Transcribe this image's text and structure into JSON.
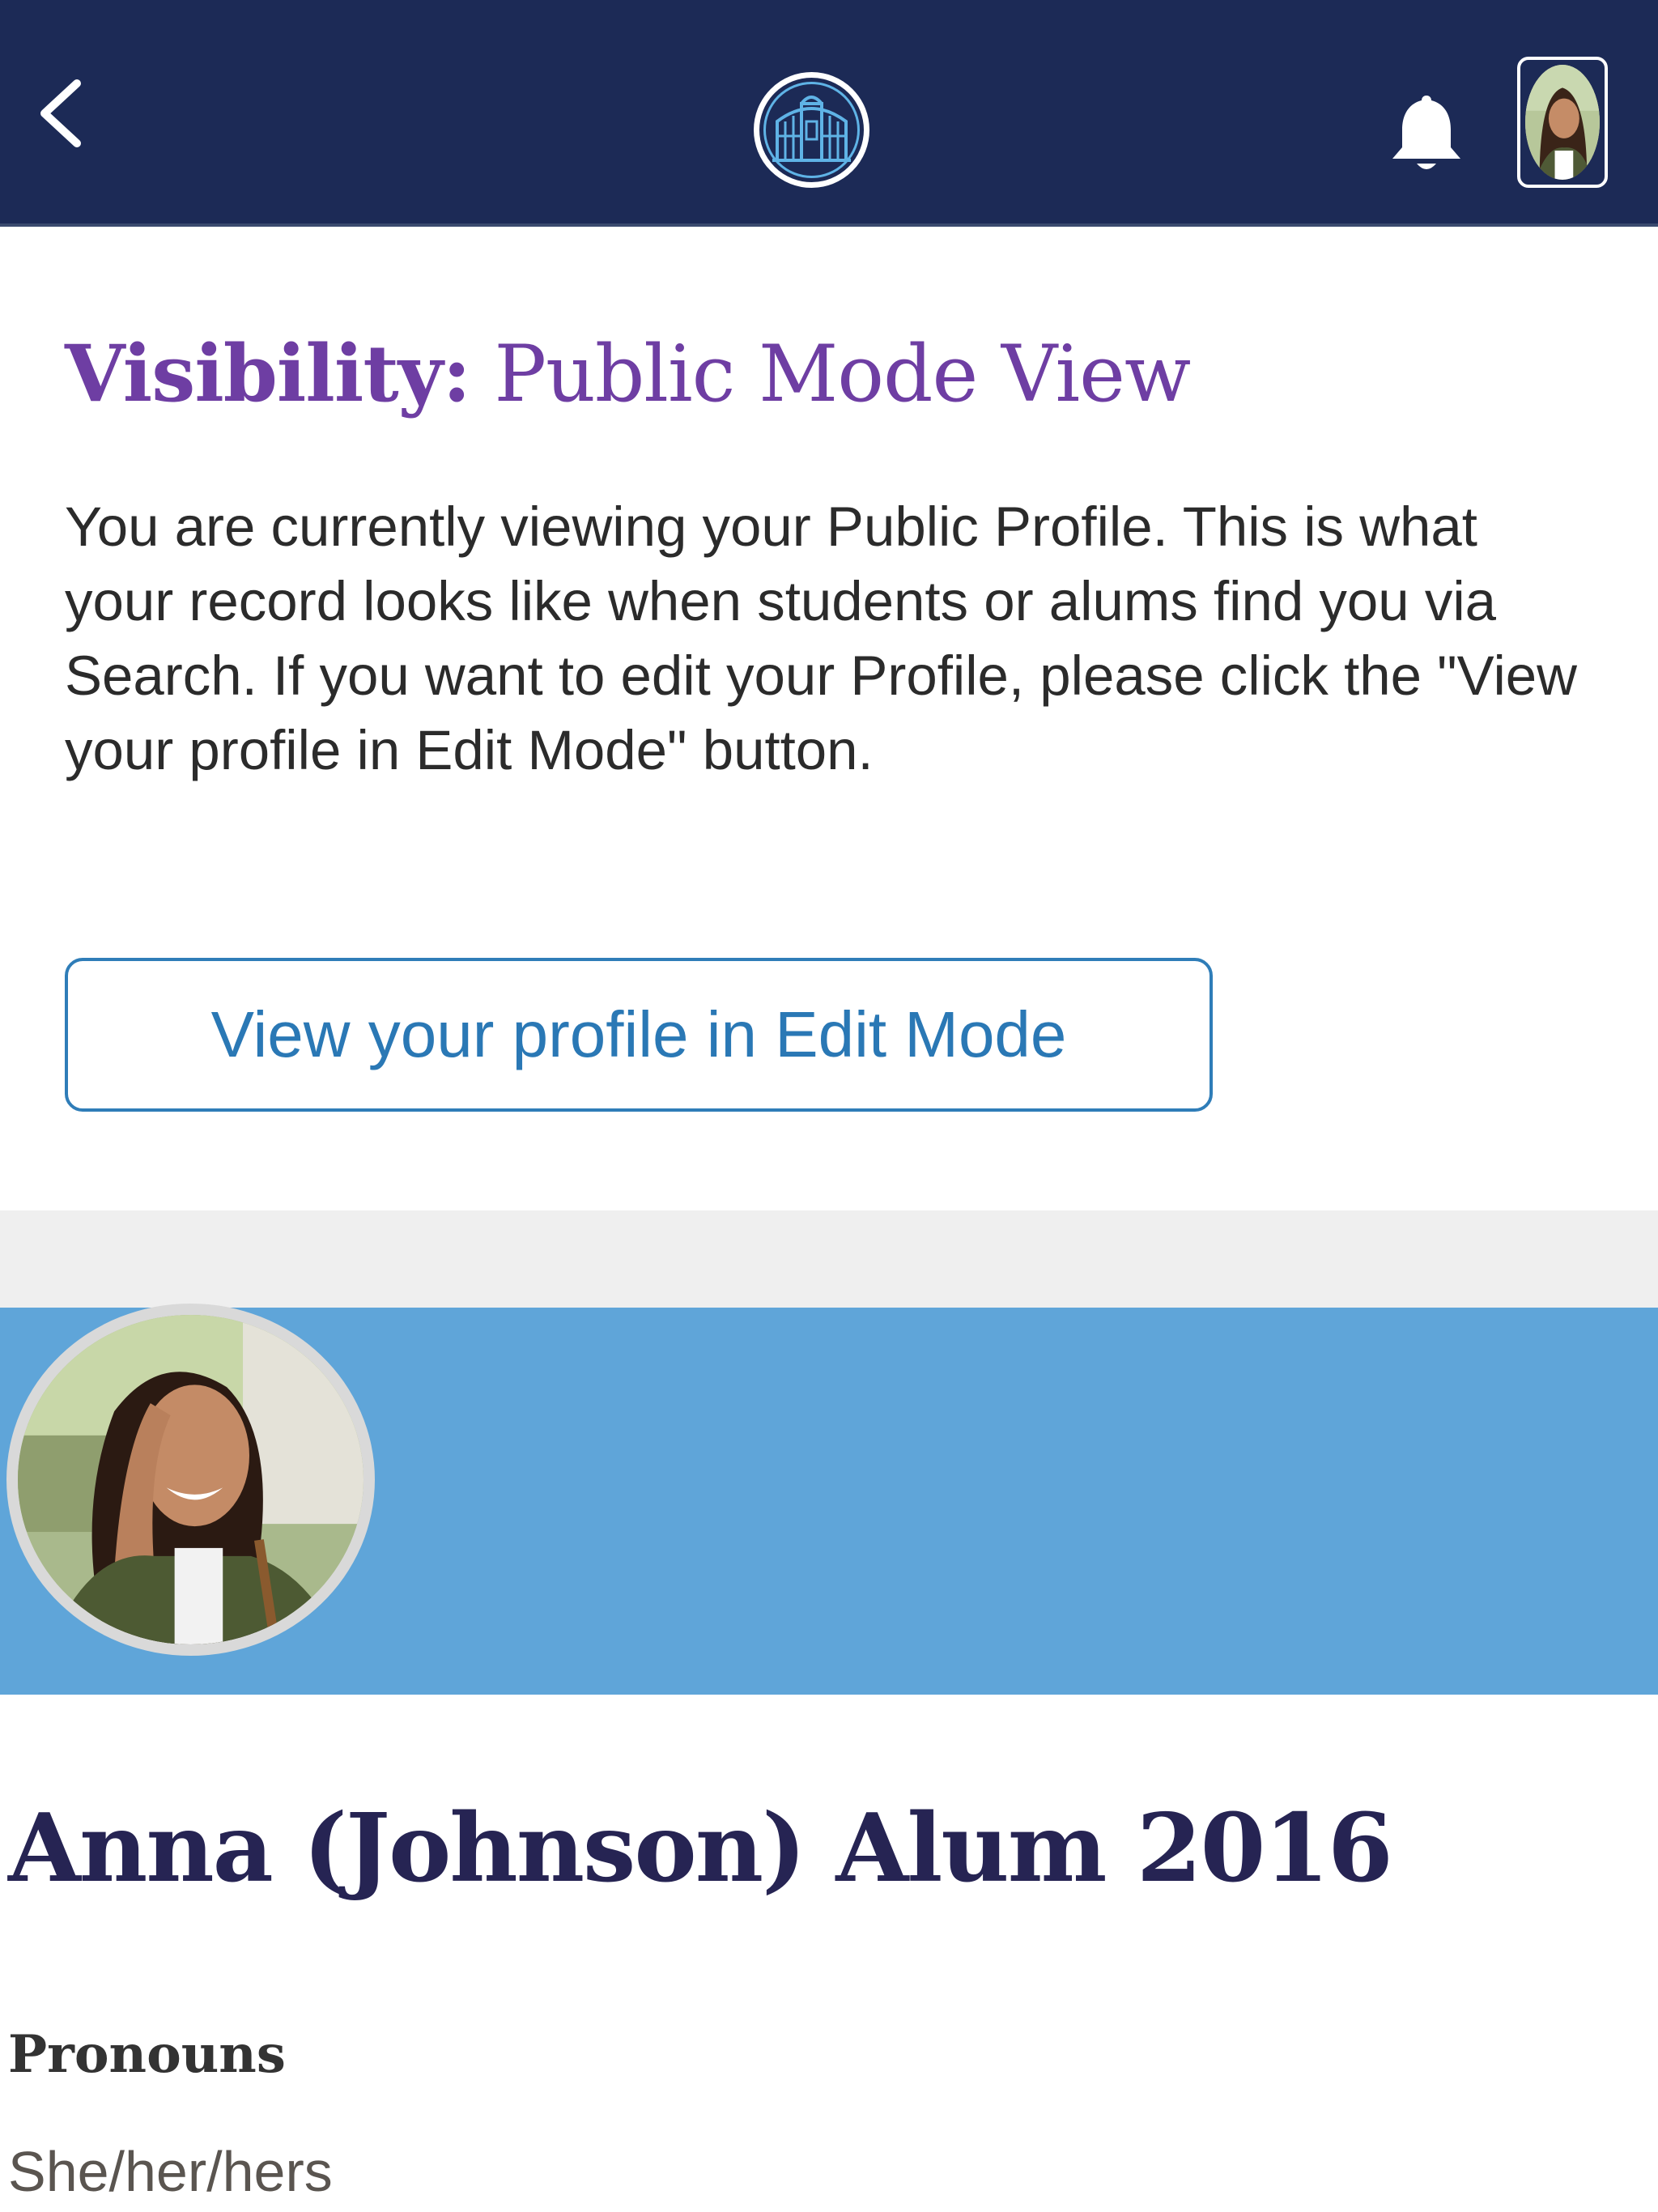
{
  "header": {
    "back_icon": "chevron-left-icon",
    "logo_icon": "gate-logo-icon",
    "notifications_icon": "bell-icon",
    "colors": {
      "background": "#1c2a56",
      "logo_accent": "#5fb3e6"
    }
  },
  "visibility": {
    "label": "Visibility:",
    "value": "Public Mode View",
    "description": "You are currently viewing your Public Profile. This is what your record looks like when students or alums find you via Search. If you want to edit your Profile, please click the \"View your profile in Edit Mode\" button.",
    "button_label": "View your profile in Edit Mode",
    "colors": {
      "title": "#6e3ea3",
      "button": "#2a78b5"
    }
  },
  "profile": {
    "banner_color": "#5fa5d9",
    "name": "Anna (Johnson) Alum 2016",
    "pronouns_label": "Pronouns",
    "pronouns_value": "She/her/hers"
  }
}
